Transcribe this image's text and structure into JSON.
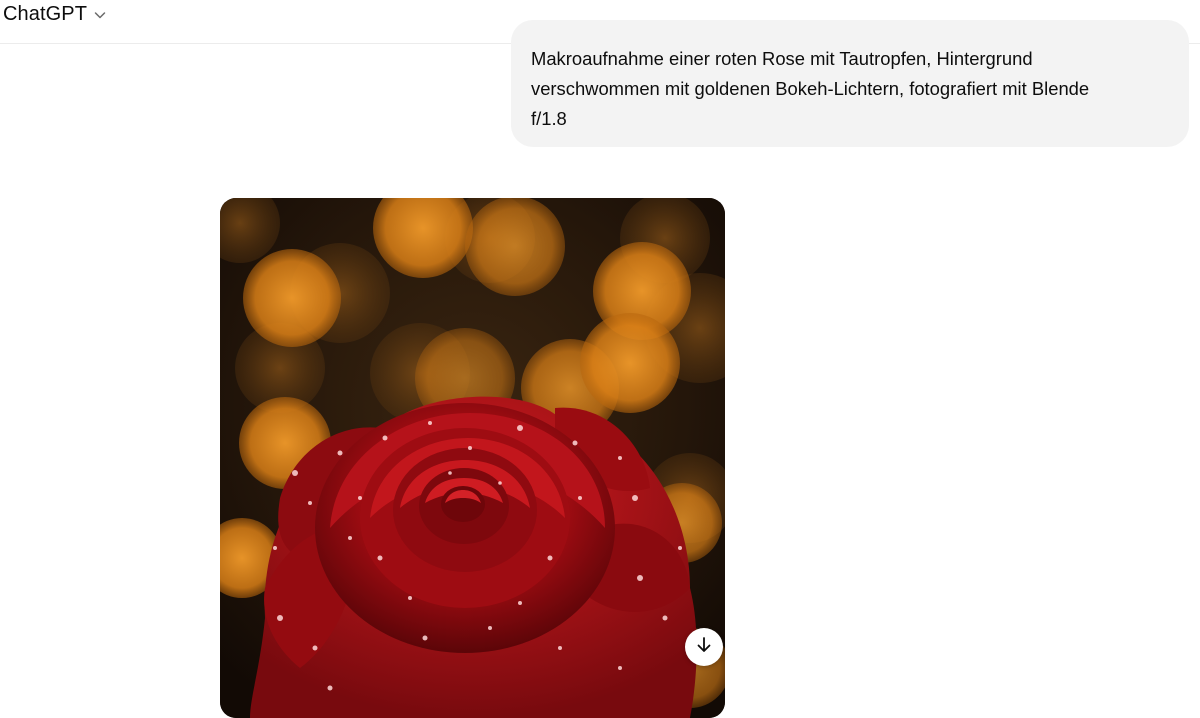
{
  "header": {
    "model_name": "ChatGPT",
    "switcher_icon": "chevron-down-icon"
  },
  "conversation": {
    "user_message": "Makroaufnahme einer roten Rose mit Tautropfen, Hintergrund\nverschwommen mit goldenen Bokeh-Lichtern, fotografiert mit Blende\nf/1.8",
    "generated_image": {
      "subject": "red-rose-with-dewdrops-bokeh",
      "download_icon": "download-arrow-icon"
    }
  },
  "colors": {
    "bubble_bg": "#f3f3f3",
    "text": "#0d0d0d",
    "divider": "#ececec",
    "bokeh": "#e08a1e",
    "rose": "#a10d12"
  }
}
